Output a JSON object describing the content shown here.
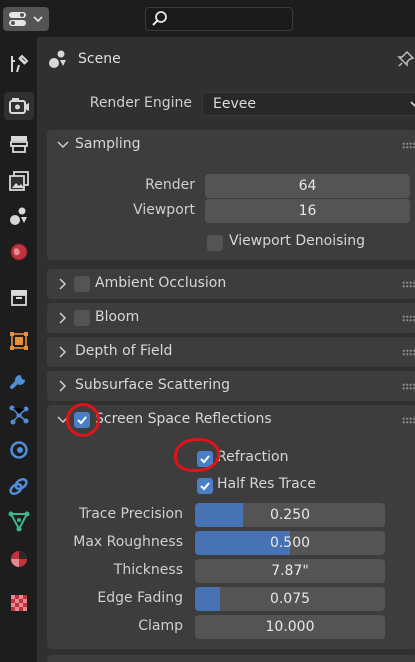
{
  "header": {
    "search_placeholder": ""
  },
  "breadcrumb": {
    "label": "Scene"
  },
  "render_engine": {
    "label": "Render Engine",
    "value": "Eevee"
  },
  "sampling": {
    "title": "Sampling",
    "render_label": "Render",
    "render_value": "64",
    "viewport_label": "Viewport",
    "viewport_value": "16",
    "denoise_label": "Viewport Denoising",
    "denoise_checked": false
  },
  "panels": {
    "ambient_occlusion": {
      "title": "Ambient Occlusion",
      "enabled": false
    },
    "bloom": {
      "title": "Bloom",
      "enabled": false
    },
    "depth_of_field": {
      "title": "Depth of Field"
    },
    "subsurface_scattering": {
      "title": "Subsurface Scattering"
    }
  },
  "ssr": {
    "title": "Screen Space Reflections",
    "enabled": true,
    "refraction_label": "Refraction",
    "refraction_checked": true,
    "half_res_label": "Half Res Trace",
    "half_res_checked": true,
    "fields": [
      {
        "label": "Trace Precision",
        "value": "0.250",
        "fill_fraction": 0.25
      },
      {
        "label": "Max Roughness",
        "value": "0.500",
        "fill_fraction": 0.5
      },
      {
        "label": "Thickness",
        "value": "7.87\"",
        "fill_fraction": 0
      },
      {
        "label": "Edge Fading",
        "value": "0.075",
        "fill_fraction": 0.13
      },
      {
        "label": "Clamp",
        "value": "10.000",
        "fill_fraction": 0
      }
    ]
  },
  "sidebar_tabs": [
    "tool-icon",
    "render-icon",
    "output-icon",
    "view-layer-icon",
    "scene-icon",
    "world-icon",
    "collection-icon",
    "object-icon",
    "modifier-icon",
    "particles-icon",
    "physics-icon",
    "constraints-icon",
    "data-icon",
    "material-icon",
    "texture-icon"
  ],
  "colors": {
    "accent_blue": "#4772b3",
    "checkbox_blue": "#4a7fc7",
    "annotation_red": "#e0131b"
  }
}
